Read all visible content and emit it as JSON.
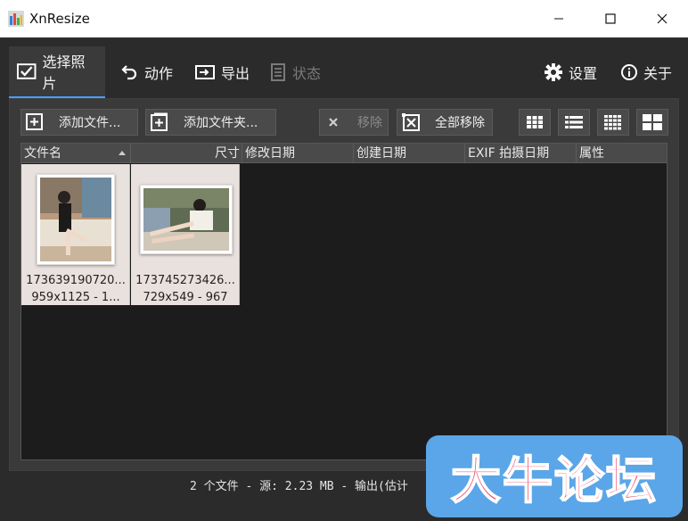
{
  "window": {
    "title": "XnResize"
  },
  "tabs": [
    {
      "label": "选择照片",
      "icon": "checked-image-icon",
      "active": true
    },
    {
      "label": "动作",
      "icon": "undo-arrow-icon"
    },
    {
      "label": "导出",
      "icon": "export-icon"
    },
    {
      "label": "状态",
      "icon": "list-doc-icon",
      "disabled": true
    },
    {
      "label": "设置",
      "icon": "gear-icon"
    },
    {
      "label": "关于",
      "icon": "info-icon"
    }
  ],
  "toolbar": {
    "add_files": "添加文件...",
    "add_folder": "添加文件夹...",
    "remove": "移除",
    "remove_all": "全部移除"
  },
  "list": {
    "columns": [
      "文件名",
      "尺寸",
      "修改日期",
      "创建日期",
      "EXIF 拍摄日期",
      "属性"
    ],
    "items": [
      {
        "name": "173639190720...",
        "info": "959x1125 - 1..."
      },
      {
        "name": "173745273426...",
        "info": "729x549 - 967"
      }
    ]
  },
  "status": {
    "text": "2 个文件 - 源: 2.23 MB - 输出(估计"
  },
  "watermark": {
    "text": "大牛论坛"
  },
  "colors": {
    "accent": "#4a9fff",
    "background": "#2b2b2b",
    "panel": "#3a3a3a",
    "list_bg": "#1c1c1c",
    "watermark_bg": "#5aa6e8",
    "watermark_text": "#e8335b"
  }
}
